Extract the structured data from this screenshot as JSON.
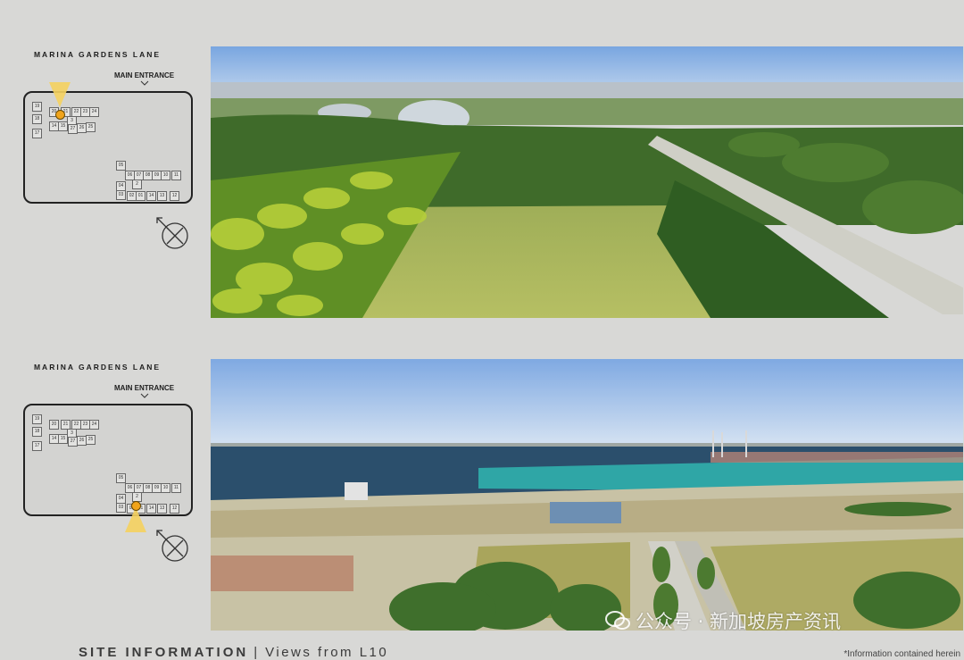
{
  "lane_label": "MARINA GARDENS LANE",
  "entrance_label": "MAIN ENTRANCE",
  "units_left": [
    {
      "id": "19"
    },
    {
      "id": "18"
    },
    {
      "id": "17"
    },
    {
      "id": "20"
    },
    {
      "id": "21"
    },
    {
      "id": "22"
    },
    {
      "id": "23"
    },
    {
      "id": "24"
    },
    {
      "id": "14"
    },
    {
      "id": "15"
    },
    {
      "id": "3"
    },
    {
      "id": "27"
    },
    {
      "id": "26"
    },
    {
      "id": "25"
    }
  ],
  "units_right": [
    {
      "id": "05"
    },
    {
      "id": "06"
    },
    {
      "id": "07"
    },
    {
      "id": "08"
    },
    {
      "id": "09"
    },
    {
      "id": "10"
    },
    {
      "id": "11"
    },
    {
      "id": "04"
    },
    {
      "id": "2"
    },
    {
      "id": "03"
    },
    {
      "id": "02"
    },
    {
      "id": "01"
    },
    {
      "id": "14"
    },
    {
      "id": "13"
    },
    {
      "id": "12"
    }
  ],
  "views": [
    {
      "position": "top",
      "marker": "main-entrance",
      "scene": "gardens-aerial"
    },
    {
      "position": "bottom",
      "marker": "south-corner",
      "scene": "waterfront-aerial"
    }
  ],
  "footer": {
    "section": "SITE INFORMATION",
    "separator": "|",
    "subtitle": "Views from L10"
  },
  "disclaimer": "*Information contained herein",
  "watermark": "公众号 · 新加坡房产资讯",
  "colors": {
    "marker": "#f0a41b",
    "cone": "#f5d25f",
    "sky": "#8fb6e4",
    "sea": "#2b4f6c",
    "lagoon": "#2fa6a6",
    "lawn": "#a9b25a",
    "trees": "#4a7a26"
  }
}
